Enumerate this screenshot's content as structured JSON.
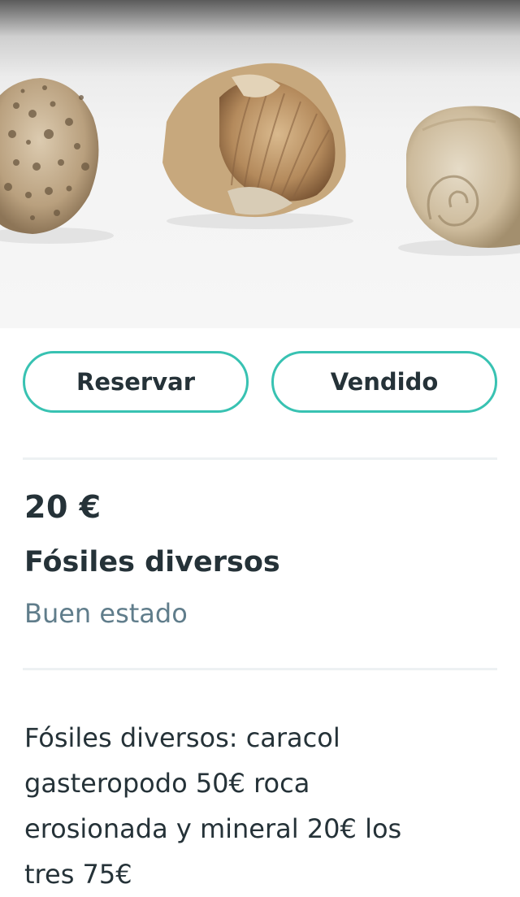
{
  "listing": {
    "photo_alt": "fossil-photo",
    "actions": {
      "reserve_label": "Reservar",
      "sold_label": "Vendido",
      "accent_color": "#38c2b2"
    },
    "price": "20 €",
    "title": "Fósiles diversos",
    "condition": "Buen estado",
    "description": "Fósiles diversos: caracol gasteropodo 50€ roca erosionada y mineral 20€ los tres 75€"
  }
}
